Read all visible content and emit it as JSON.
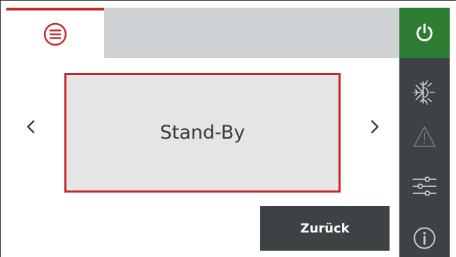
{
  "header": {
    "menu_icon": "hamburger-menu-icon"
  },
  "sidebar": {
    "items": [
      {
        "icon": "power-icon",
        "active": true
      },
      {
        "icon": "snowflake-sun-icon"
      },
      {
        "icon": "warning-icon"
      },
      {
        "icon": "sliders-icon"
      },
      {
        "icon": "info-icon"
      }
    ]
  },
  "main": {
    "status_label": "Stand-By",
    "prev_icon": "chevron-left-icon",
    "next_icon": "chevron-right-icon",
    "back_label": "Zurück"
  },
  "colors": {
    "accent_red": "#c62828",
    "power_green": "#2e7d32",
    "dark_gray": "#3d4244",
    "panel_gray": "#e3e5e6",
    "topbar_gray": "#cfd2d4"
  }
}
